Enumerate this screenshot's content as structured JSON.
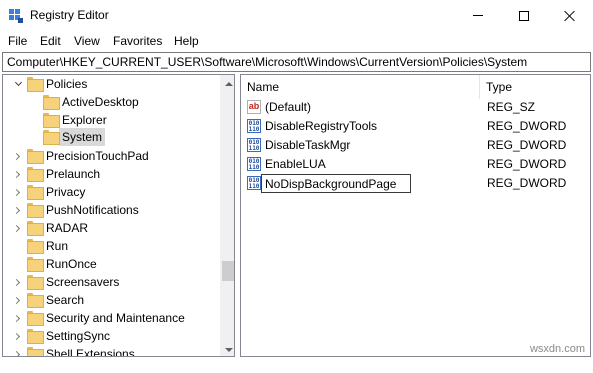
{
  "window": {
    "title": "Registry Editor",
    "icon": "registry-editor-icon"
  },
  "menu": [
    "File",
    "Edit",
    "View",
    "Favorites",
    "Help"
  ],
  "address": "Computer\\HKEY_CURRENT_USER\\Software\\Microsoft\\Windows\\CurrentVersion\\Policies\\System",
  "tree": {
    "items": [
      {
        "label": "Policies",
        "expander": "expanded"
      },
      {
        "label": "ActiveDesktop",
        "expander": "none"
      },
      {
        "label": "Explorer",
        "expander": "none"
      },
      {
        "label": "System",
        "expander": "none",
        "selected": true
      },
      {
        "label": "PrecisionTouchPad",
        "expander": "collapsed"
      },
      {
        "label": "Prelaunch",
        "expander": "collapsed"
      },
      {
        "label": "Privacy",
        "expander": "collapsed"
      },
      {
        "label": "PushNotifications",
        "expander": "collapsed"
      },
      {
        "label": "RADAR",
        "expander": "collapsed"
      },
      {
        "label": "Run",
        "expander": "none"
      },
      {
        "label": "RunOnce",
        "expander": "none"
      },
      {
        "label": "Screensavers",
        "expander": "collapsed"
      },
      {
        "label": "Search",
        "expander": "collapsed"
      },
      {
        "label": "Security and Maintenance",
        "expander": "collapsed"
      },
      {
        "label": "SettingSync",
        "expander": "collapsed"
      },
      {
        "label": "Shell Extensions",
        "expander": "collapsed"
      }
    ]
  },
  "list": {
    "columns": {
      "name": "Name",
      "type": "Type"
    },
    "rows": [
      {
        "icon": "string-value-icon",
        "name": "(Default)",
        "type": "REG_SZ"
      },
      {
        "icon": "binary-value-icon",
        "name": "DisableRegistryTools",
        "type": "REG_DWORD"
      },
      {
        "icon": "binary-value-icon",
        "name": "DisableTaskMgr",
        "type": "REG_DWORD"
      },
      {
        "icon": "binary-value-icon",
        "name": "EnableLUA",
        "type": "REG_DWORD"
      },
      {
        "icon": "binary-value-icon",
        "name": "NoDispBackgroundPage",
        "type": "REG_DWORD",
        "editing": true
      }
    ]
  },
  "watermark": "wsxdn.com",
  "colors": {
    "folder": "#f6d27a",
    "selection": "#d9d9d9",
    "string_icon": "#c2261e",
    "binary_icon": "#1f4c9e"
  }
}
